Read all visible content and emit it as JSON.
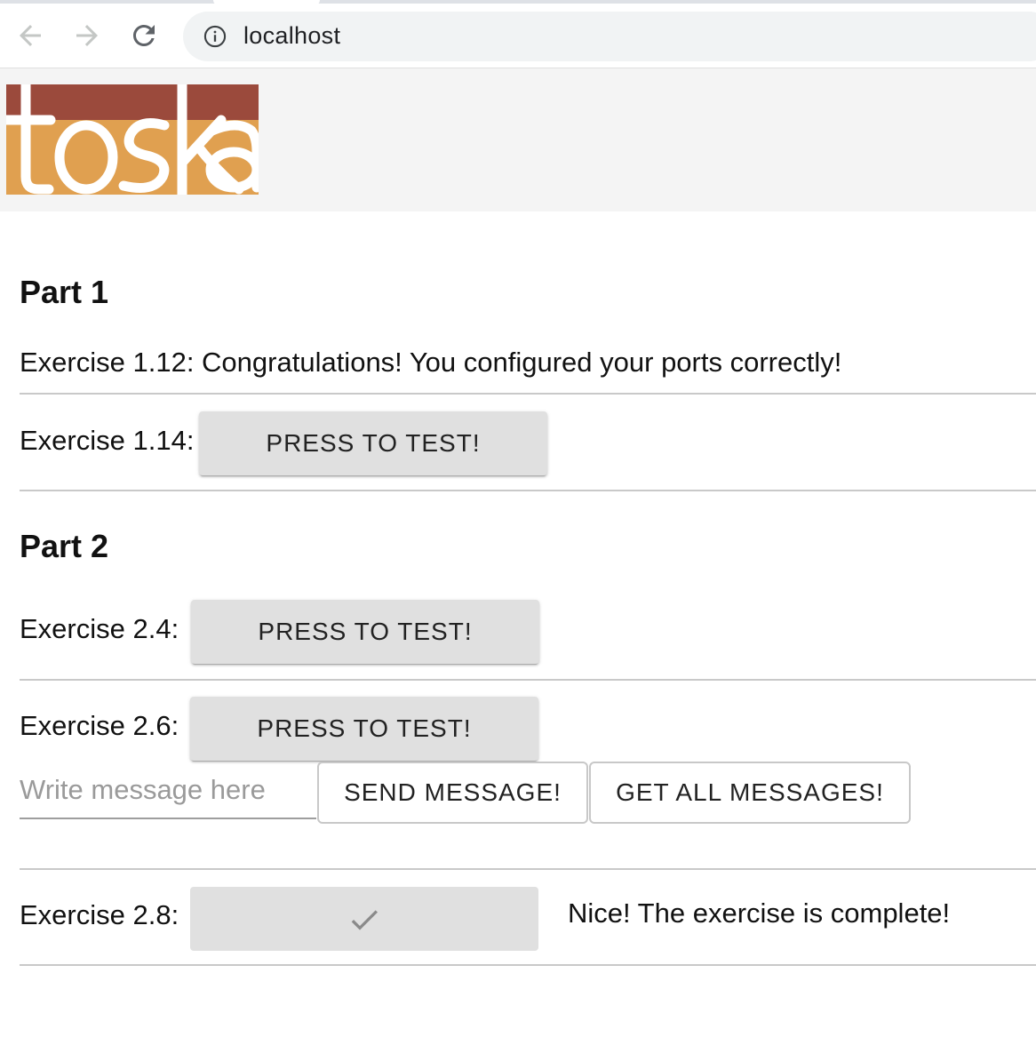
{
  "browser": {
    "url": "localhost"
  },
  "header": {
    "logo_text": "toska",
    "logo_colors": {
      "top": "#9b4a3c",
      "bottom": "#e0a050"
    }
  },
  "part1": {
    "title": "Part 1",
    "ex_1_12": "Exercise 1.12: Congratulations! You configured your ports correctly!",
    "ex_1_14": {
      "label": "Exercise 1.14:",
      "button": "PRESS TO TEST!"
    }
  },
  "part2": {
    "title": "Part 2",
    "ex_2_4": {
      "label": "Exercise 2.4:",
      "button": "PRESS TO TEST!"
    },
    "ex_2_6": {
      "label": "Exercise 2.6:",
      "button": "PRESS TO TEST!",
      "input_value": "",
      "input_placeholder": "Write message here",
      "send_button": "SEND MESSAGE!",
      "get_all_button": "GET ALL MESSAGES!"
    },
    "ex_2_8": {
      "label": "Exercise 2.8:",
      "button_icon": "check-icon",
      "result": "Nice! The exercise is complete!"
    }
  },
  "colors": {
    "button_bg": "#e0e0e0",
    "header_bg": "#f4f4f4",
    "divider": "#c9c9c9"
  }
}
